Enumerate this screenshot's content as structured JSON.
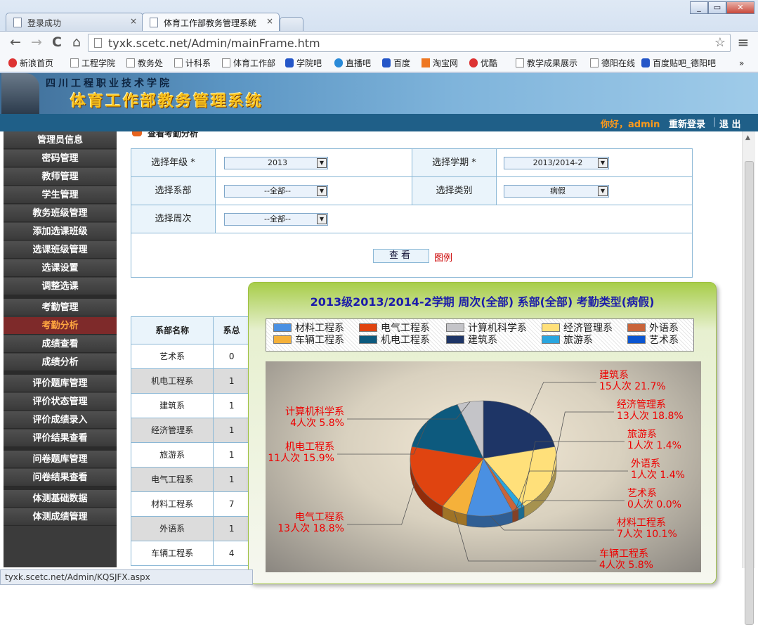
{
  "browser": {
    "tabs": [
      {
        "label": "登录成功",
        "close": "×"
      },
      {
        "label": "体育工作部教务管理系统",
        "close": "×"
      }
    ],
    "window_buttons": [
      "_",
      "▭",
      "✕"
    ],
    "nav": {
      "back": "←",
      "forward": "→",
      "reload": "C",
      "home": "⌂"
    },
    "url": "tyxk.scetc.net/Admin/mainFrame.htm",
    "menu_glyph": "≡",
    "star_glyph": "☆",
    "bookmarks": [
      {
        "label": "新浪首页",
        "icon": "weibo-icon"
      },
      {
        "label": "工程学院",
        "icon": "page-icon"
      },
      {
        "label": "教务处",
        "icon": "page-icon"
      },
      {
        "label": "计科系",
        "icon": "page-icon"
      },
      {
        "label": "体育工作部",
        "icon": "page-icon"
      },
      {
        "label": "学院吧",
        "icon": "baidu-paw-icon"
      },
      {
        "label": "直播吧",
        "icon": "zhibo-icon"
      },
      {
        "label": "百度",
        "icon": "baidu-paw-icon"
      },
      {
        "label": "淘宝网",
        "icon": "taobao-icon"
      },
      {
        "label": "优酷",
        "icon": "youku-icon"
      },
      {
        "label": "教学成果展示",
        "icon": "page-icon"
      },
      {
        "label": "德阳在线",
        "icon": "page-icon"
      },
      {
        "label": "百度贴吧_德阳吧",
        "icon": "baidu-paw-icon"
      }
    ],
    "more": "»",
    "status_url": "tyxk.scetc.net/Admin/KQSJFX.aspx"
  },
  "header": {
    "school": "四川工程职业技术学院",
    "system": "体育工作部教务管理系统",
    "greeting": "你好，admin",
    "relogin": "重新登录",
    "separator": "|",
    "logout": "退 出"
  },
  "sidebar": {
    "items": [
      {
        "label": "管理员信息"
      },
      {
        "label": "密码管理"
      },
      {
        "label": "教师管理"
      },
      {
        "label": "学生管理"
      },
      {
        "label": "教务班级管理"
      },
      {
        "label": "添加选课班级"
      },
      {
        "label": "选课班级管理"
      },
      {
        "label": "选课设置"
      },
      {
        "label": "调整选课"
      },
      {
        "label": "考勤管理"
      },
      {
        "label": "考勤分析"
      },
      {
        "label": "成绩查看"
      },
      {
        "label": "成绩分析"
      },
      {
        "label": "评价题库管理"
      },
      {
        "label": "评价状态管理"
      },
      {
        "label": "评价成绩录入"
      },
      {
        "label": "评价结果查看"
      },
      {
        "label": "问卷题库管理"
      },
      {
        "label": "问卷结果查看"
      },
      {
        "label": "体测基础数据"
      },
      {
        "label": "体测成绩管理"
      }
    ],
    "active_label": "考勤分析"
  },
  "form": {
    "cut_title": "查看考勤分析",
    "grade_label": "选择年级 *",
    "grade_value": "2013",
    "term_label": "选择学期 *",
    "term_value": "2013/2014-2",
    "dept_label": "选择系部",
    "dept_value": "--全部--",
    "type_label": "选择类别",
    "type_value": "病假",
    "week_label": "选择周次",
    "week_value": "--全部--",
    "query_button": "查看",
    "legend_link": "图例",
    "dropdown_glyph": "▼"
  },
  "table": {
    "headers": [
      "系部名称",
      "系总"
    ],
    "rows": [
      {
        "name": "艺术系",
        "v": "0"
      },
      {
        "name": "机电工程系",
        "v": "1"
      },
      {
        "name": "建筑系",
        "v": "1"
      },
      {
        "name": "经济管理系",
        "v": "1"
      },
      {
        "name": "旅游系",
        "v": "1"
      },
      {
        "name": "电气工程系",
        "v": "1"
      },
      {
        "name": "材料工程系",
        "v": "7"
      },
      {
        "name": "外语系",
        "v": "1"
      },
      {
        "name": "车辆工程系",
        "v": "4"
      }
    ]
  },
  "popup": {
    "title": "2013级2013/2014-2学期 周次(全部) 系部(全部) 考勤类型(病假)"
  },
  "chart_data": {
    "type": "pie",
    "title": "2013级2013/2014-2学期 周次(全部) 系部(全部) 考勤类型(病假)",
    "legend_placement": "top",
    "legend": [
      {
        "name": "材料工程系",
        "color": "#4a90e2"
      },
      {
        "name": "电气工程系",
        "color": "#e04410"
      },
      {
        "name": "计算机科学系",
        "color": "#c4c4c8"
      },
      {
        "name": "经济管理系",
        "color": "#ffe07a"
      },
      {
        "name": "外语系",
        "color": "#c9643a"
      },
      {
        "name": "车辆工程系",
        "color": "#f5b13a"
      },
      {
        "name": "机电工程系",
        "color": "#0d5a7e"
      },
      {
        "name": "建筑系",
        "color": "#1e3566"
      },
      {
        "name": "旅游系",
        "color": "#2aa6df"
      },
      {
        "name": "艺术系",
        "color": "#0a55d0"
      }
    ],
    "slices": [
      {
        "name": "建筑系",
        "count": 15,
        "pct": 21.7,
        "label": "15人次 21.7%",
        "color": "#1e3566"
      },
      {
        "name": "经济管理系",
        "count": 13,
        "pct": 18.8,
        "label": "13人次 18.8%",
        "color": "#ffe07a"
      },
      {
        "name": "旅游系",
        "count": 1,
        "pct": 1.4,
        "label": "1人次 1.4%",
        "color": "#2aa6df"
      },
      {
        "name": "外语系",
        "count": 1,
        "pct": 1.4,
        "label": "1人次 1.4%",
        "color": "#c9643a"
      },
      {
        "name": "艺术系",
        "count": 0,
        "pct": 0.0,
        "label": "0人次 0.0%",
        "color": "#0a55d0"
      },
      {
        "name": "材料工程系",
        "count": 7,
        "pct": 10.1,
        "label": "7人次 10.1%",
        "color": "#4a90e2"
      },
      {
        "name": "车辆工程系",
        "count": 4,
        "pct": 5.8,
        "label": "4人次 5.8%",
        "color": "#f5b13a"
      },
      {
        "name": "电气工程系",
        "count": 13,
        "pct": 18.8,
        "label": "13人次 18.8%",
        "color": "#e04410"
      },
      {
        "name": "机电工程系",
        "count": 11,
        "pct": 15.9,
        "label": "11人次 15.9%",
        "color": "#0d5a7e"
      },
      {
        "name": "计算机科学系",
        "count": 4,
        "pct": 5.8,
        "label": "4人次 5.8%",
        "color": "#c4c4c8"
      }
    ]
  }
}
